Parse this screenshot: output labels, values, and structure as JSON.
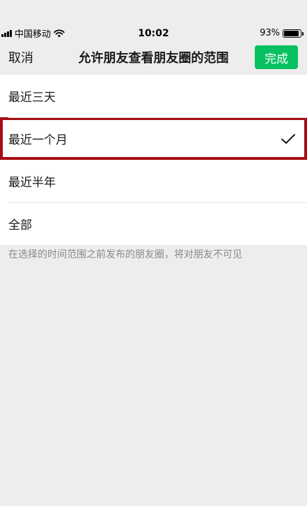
{
  "status_bar": {
    "carrier": "中国移动",
    "time": "10:02",
    "battery_text": "93%",
    "battery_level": 0.93
  },
  "nav": {
    "cancel_label": "取消",
    "title": "允许朋友查看朋友圈的范围",
    "done_label": "完成",
    "done_color": "#07c160"
  },
  "options": [
    {
      "label": "最近三天",
      "selected": false
    },
    {
      "label": "最近一个月",
      "selected": true
    },
    {
      "label": "最近半年",
      "selected": false
    },
    {
      "label": "全部",
      "selected": false
    }
  ],
  "hint": "在选择的时间范围之前发布的朋友圈，将对朋友不可见",
  "icons": {
    "selected_indicator": "checkmark-icon",
    "wifi": "wifi-icon",
    "signal": "signal-icon",
    "battery": "battery-icon"
  },
  "highlight_color": "#a60d14"
}
